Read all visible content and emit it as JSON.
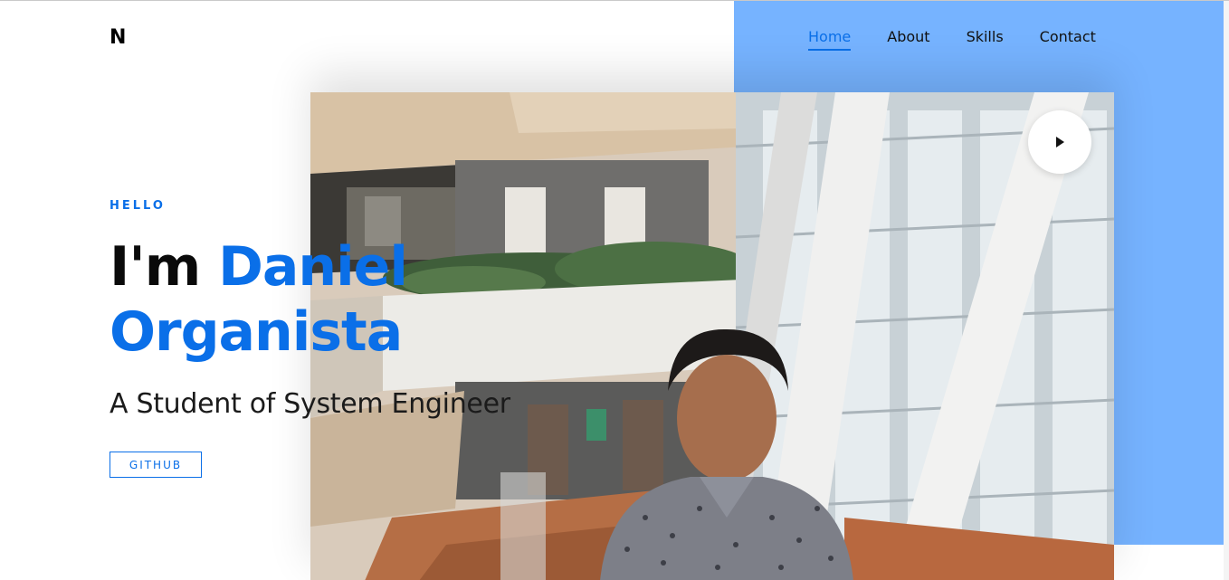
{
  "brand": {
    "logo": "N"
  },
  "nav": {
    "items": [
      {
        "label": "Home",
        "active": true
      },
      {
        "label": "About",
        "active": false
      },
      {
        "label": "Skills",
        "active": false
      },
      {
        "label": "Contact",
        "active": false
      }
    ]
  },
  "hero": {
    "greeting": "HELLO",
    "prefix": "I'm",
    "first_name": "Daniel",
    "last_name": "Organista",
    "subtitle": "A Student of System Engineer",
    "github_label": "GITHUB"
  },
  "media": {
    "play_icon": "play-icon",
    "photo_subject": "portrait"
  },
  "colors": {
    "accent": "#0a6fe8",
    "panel": "#76b3ff",
    "text": "#0a0a0a"
  }
}
